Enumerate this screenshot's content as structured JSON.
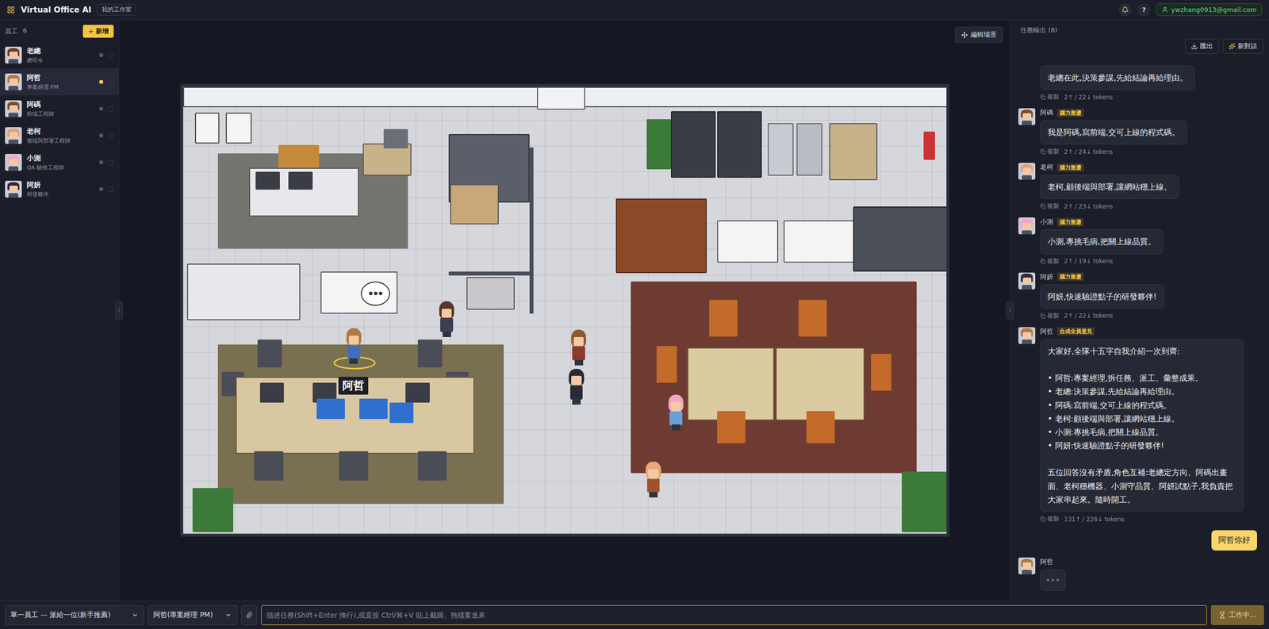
{
  "app": {
    "title": "Virtual Office AI",
    "workspace": "我的工作室"
  },
  "topbar": {
    "help": "?",
    "user": "ywzhang0913@gmail.com",
    "notify_on": true
  },
  "sidebar": {
    "title": "員工",
    "count": "6",
    "add_button": "新增",
    "items": [
      {
        "name": "老總",
        "role": "總司令",
        "selected": false,
        "busy": false
      },
      {
        "name": "阿哲",
        "role": "專案經理 PM",
        "selected": true,
        "busy": true
      },
      {
        "name": "阿碼",
        "role": "前端工程師",
        "selected": false,
        "busy": false
      },
      {
        "name": "老柯",
        "role": "後端與部署工程師",
        "selected": false,
        "busy": false
      },
      {
        "name": "小測",
        "role": "QA 驗收工程師",
        "selected": false,
        "busy": false
      },
      {
        "name": "阿妍",
        "role": "研發夥伴",
        "selected": false,
        "busy": false
      }
    ]
  },
  "scene": {
    "edit_button": "編輯場景",
    "selected_label": "阿哲"
  },
  "output": {
    "title": "任務輸出 (8)",
    "export_button": "匯出",
    "new_button": "新對話",
    "copy_label": "複製",
    "messages": [
      {
        "kind": "cut",
        "text": "老總在此,決策參謀,先給結論再給理由。",
        "tokens": "2↑ / 22↓ tokens"
      },
      {
        "kind": "agent",
        "name": "阿碼",
        "badge": "腦力激盪",
        "text": "我是阿碼,寫前端,交可上線的程式碼。",
        "tokens": "2↑ / 24↓ tokens"
      },
      {
        "kind": "agent",
        "name": "老柯",
        "badge": "腦力激盪",
        "text": "老柯,顧後端與部署,讓網站穩上線。",
        "tokens": "2↑ / 23↓ tokens"
      },
      {
        "kind": "agent",
        "name": "小測",
        "badge": "腦力激盪",
        "text": "小測,專挑毛病,把關上線品質。",
        "tokens": "2↑ / 19↓ tokens"
      },
      {
        "kind": "agent",
        "name": "阿妍",
        "badge": "腦力激盪",
        "text": "阿妍,快速驗證點子的研發夥伴!",
        "tokens": "2↑ / 22↓ tokens"
      },
      {
        "kind": "agent",
        "name": "阿哲",
        "badge": "合成全員意見",
        "text": "大家好,全隊十五字自我介紹一次到齊:\n\n• 阿哲:專案經理,拆任務、派工、彙整成果。\n• 老總:決策參謀,先給結論再給理由。\n• 阿碼:寫前端,交可上線的程式碼。\n• 老柯:顧後端與部署,讓網站穩上線。\n• 小測:專挑毛病,把關上線品質。\n• 阿妍:快速驗證點子的研發夥伴!\n\n五位回答沒有矛盾,角色互補:老總定方向、阿碼出畫面、老柯穩機器、小測守品質、阿妍試點子,我負責把大家串起來。隨時開工。",
        "tokens": "131↑ / 226↓ tokens"
      },
      {
        "kind": "user",
        "text": "阿哲你好"
      },
      {
        "kind": "typing",
        "name": "阿哲"
      }
    ]
  },
  "composer": {
    "mode": "單一員工 — 派給一位(新手推薦)",
    "assignee": "阿哲(專案經理 PM)",
    "placeholder": "描述任務(Shift+Enter 換行),或直接 Ctrl/⌘+V 貼上截圖、拖檔案進來",
    "send_button": "工作中...",
    "busy": true
  }
}
